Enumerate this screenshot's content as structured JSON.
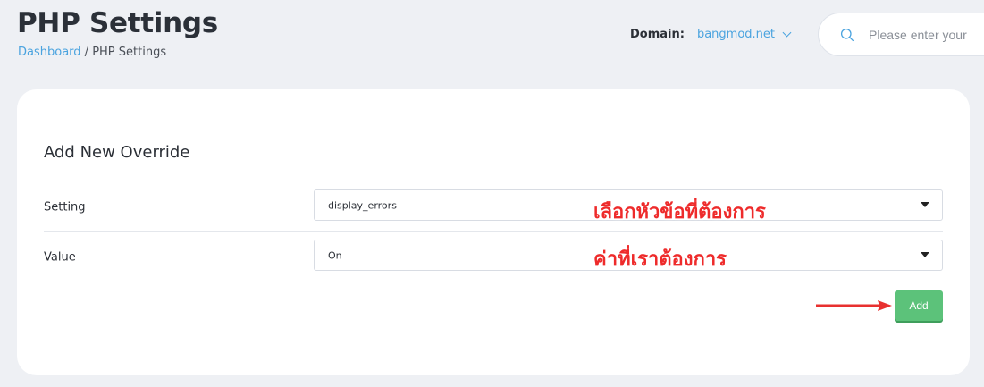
{
  "header": {
    "title": "PHP Settings",
    "breadcrumb": {
      "home": "Dashboard",
      "separator": " / ",
      "current": "PHP Settings"
    },
    "domain_label": "Domain:",
    "domain_value": "bangmod.net",
    "search_placeholder": "Please enter your"
  },
  "form": {
    "title": "Add New Override",
    "setting_label": "Setting",
    "setting_value": "display_errors",
    "value_label": "Value",
    "value_value": "On",
    "add_label": "Add"
  },
  "annotations": {
    "setting_note": "เลือกหัวข้อที่ต้องการ",
    "value_note": "ค่าที่เราต้องการ"
  },
  "colors": {
    "accent": "#4aa3df",
    "add_button": "#5cc27a",
    "annotation": "#ee2b2b"
  }
}
